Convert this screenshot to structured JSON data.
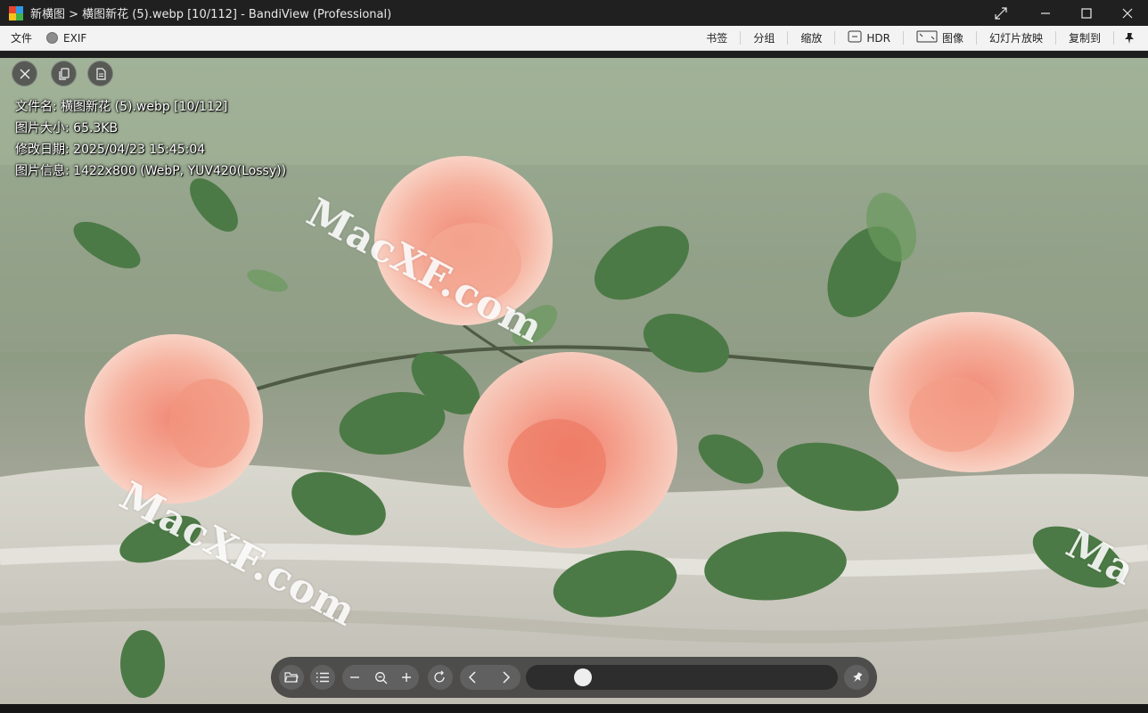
{
  "titlebar": {
    "title": "新横图 > 横图新花 (5).webp [10/112] - BandiView (Professional)",
    "logo_colors": [
      "#e8432f",
      "#2f9be8",
      "#f5c21b",
      "#3fb24a"
    ],
    "icons": {
      "expand": "expand-diagonal-icon",
      "minimize": "minimize-icon",
      "maximize": "maximize-icon",
      "close": "close-icon"
    }
  },
  "menubar": {
    "file": "文件",
    "exif": "EXIF",
    "bookmark": "书签",
    "group": "分组",
    "zoom": "缩放",
    "hdr": "HDR",
    "image": "图像",
    "slideshow": "幻灯片放映",
    "copy_to": "复制到"
  },
  "info": {
    "filename": "文件名: 横图新花 (5).webp [10/112]",
    "size": "图片大小: 65.3KB",
    "modified": "修改日期: 2025/04/23 15:45:04",
    "details": "图片信息: 1422x800 (WebP, YUV420(Lossy))"
  },
  "watermarks": [
    "MacXF.com",
    "MacXF.com",
    "Ma"
  ],
  "toolbar": {
    "buttons": [
      "open-folder-icon",
      "list-icon",
      "zoom-out-minus-icon",
      "zoom-fit-icon",
      "zoom-in-plus-icon",
      "rotate-icon",
      "prev-icon",
      "next-icon",
      "pin-icon"
    ],
    "progress": 0.1
  },
  "colors": {
    "titlebar_bg": "#202020",
    "menubar_bg": "#f3f3f3",
    "accent_rose": "#f2a08e"
  }
}
